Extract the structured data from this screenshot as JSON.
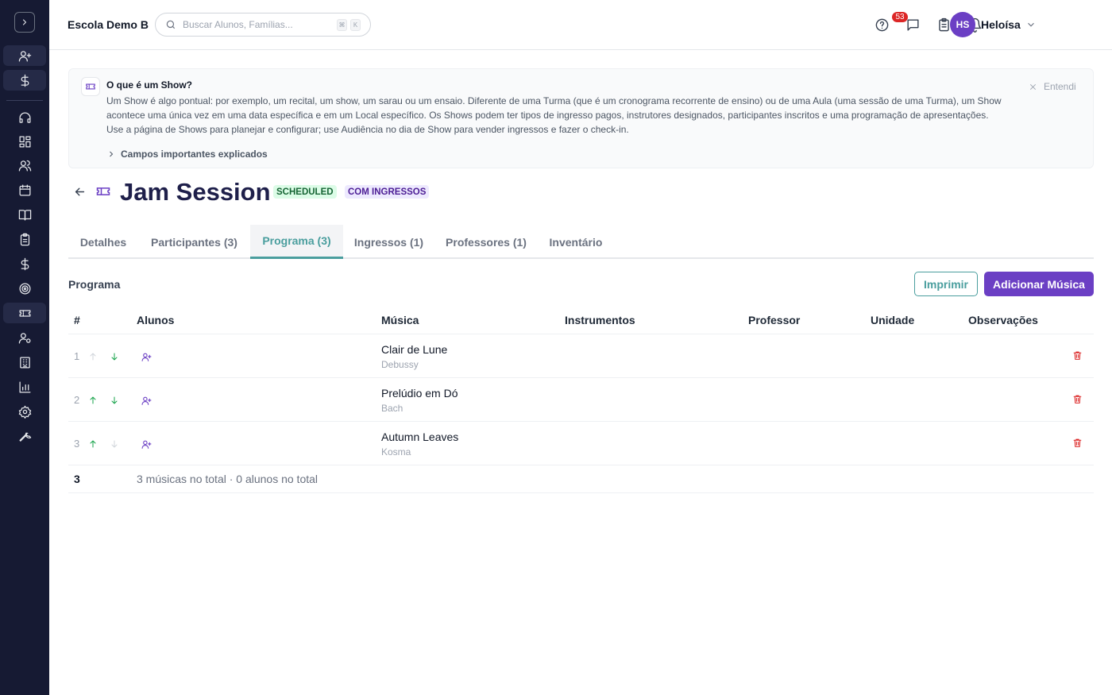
{
  "sidebar": {
    "toggle_icon": "chevron-right-icon",
    "items": [
      {
        "icon": "user-plus-icon"
      },
      {
        "icon": "dollar-icon"
      },
      {
        "icon": "headset-icon"
      },
      {
        "icon": "grid-icon"
      },
      {
        "icon": "users-icon"
      },
      {
        "icon": "calendar-icon"
      },
      {
        "icon": "book-open-icon"
      },
      {
        "icon": "clipboard-icon"
      },
      {
        "icon": "dollar-icon"
      },
      {
        "icon": "target-icon"
      },
      {
        "icon": "ticket-icon",
        "active": true
      },
      {
        "icon": "user-cog-icon"
      },
      {
        "icon": "building-icon"
      },
      {
        "icon": "bar-chart-icon"
      },
      {
        "icon": "settings-icon"
      },
      {
        "icon": "wrench-icon"
      }
    ]
  },
  "header": {
    "school_name": "Escola Demo B",
    "search_placeholder": "Buscar Alunos, Famílias...",
    "shortcut_keys": [
      "⌘",
      "K"
    ],
    "notifications_count": "53",
    "user_initials": "HS",
    "user_name": "Heloísa"
  },
  "banner": {
    "title": "O que é um Show?",
    "text": "Um Show é algo pontual: por exemplo, um recital, um show, um sarau ou um ensaio. Diferente de uma Turma (que é um cronograma recorrente de ensino) ou de uma Aula (uma sessão de uma Turma), um Show acontece uma única vez em uma data específica e em um Local específico. Os Shows podem ter tipos de ingresso pagos, instrutores designados, participantes inscritos e uma programação de apresentações. Use a página de Shows para planejar e configurar; use Audiência no dia de Show para vender ingressos e fazer o check-in.",
    "expand_label": "Campos importantes explicados",
    "dismiss_label": "Entendi"
  },
  "show": {
    "title": "Jam Session",
    "status": "SCHEDULED",
    "ticket_badge": "COM INGRESSOS"
  },
  "tabs": [
    {
      "label": "Detalhes"
    },
    {
      "label": "Participantes (3)"
    },
    {
      "label": "Programa (3)",
      "active": true
    },
    {
      "label": "Ingressos (1)"
    },
    {
      "label": "Professores (1)"
    },
    {
      "label": "Inventário"
    }
  ],
  "program": {
    "section_title": "Programa",
    "print_label": "Imprimir",
    "add_label": "Adicionar Música",
    "columns": [
      "#",
      "Alunos",
      "Música",
      "Instrumentos",
      "Professor",
      "Unidade",
      "Observações"
    ],
    "rows": [
      {
        "num": "1",
        "song": "Clair de Lune",
        "composer": "Debussy",
        "up_enabled": false,
        "down_enabled": true
      },
      {
        "num": "2",
        "song": "Prelúdio em Dó",
        "composer": "Bach",
        "up_enabled": true,
        "down_enabled": true
      },
      {
        "num": "3",
        "song": "Autumn Leaves",
        "composer": "Kosma",
        "up_enabled": true,
        "down_enabled": false
      }
    ],
    "footer_count": "3",
    "footer_summary": "3 músicas no total · 0 alunos no total"
  },
  "colors": {
    "sidebar_bg": "#161a33",
    "accent_purple": "#6b3fc4",
    "accent_teal": "#4a9e9e",
    "danger": "#dc2626",
    "success": "#16a34a"
  }
}
